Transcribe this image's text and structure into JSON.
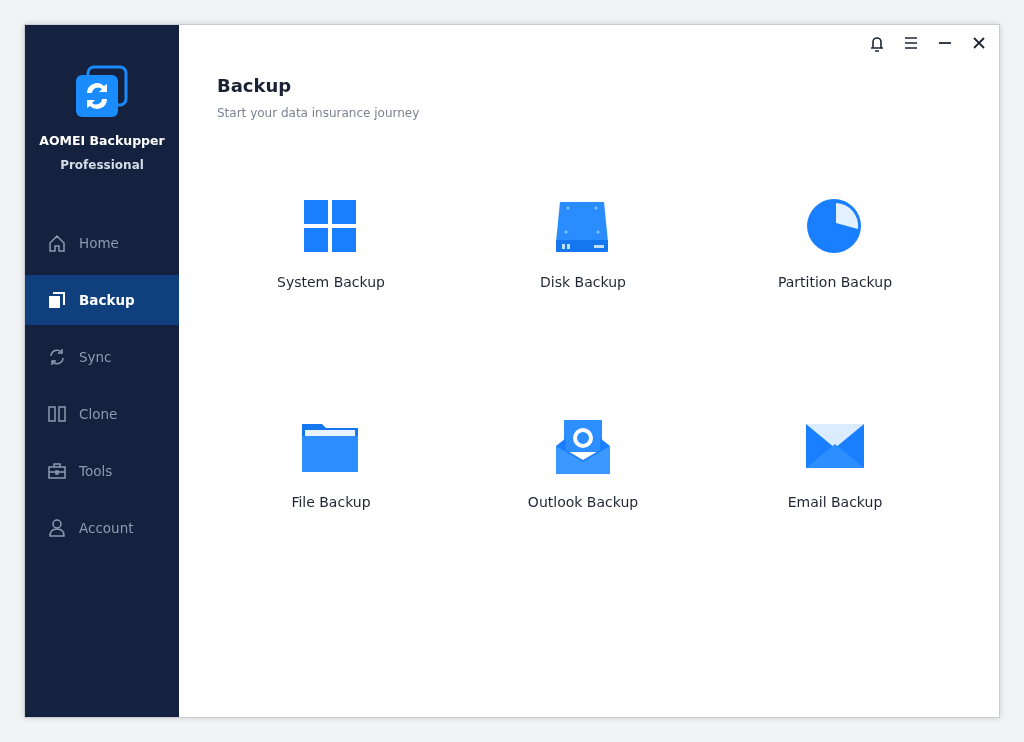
{
  "app": {
    "name": "AOMEI Backupper",
    "edition": "Professional"
  },
  "nav": [
    {
      "label": "Home",
      "kind": "home",
      "selected": false
    },
    {
      "label": "Backup",
      "kind": "backup",
      "selected": true
    },
    {
      "label": "Sync",
      "kind": "sync",
      "selected": false
    },
    {
      "label": "Clone",
      "kind": "clone",
      "selected": false
    },
    {
      "label": "Tools",
      "kind": "tools",
      "selected": false
    },
    {
      "label": "Account",
      "kind": "account",
      "selected": false
    }
  ],
  "title_bar": {
    "controls": [
      {
        "kind": "bell"
      },
      {
        "kind": "menu"
      },
      {
        "kind": "minimize"
      },
      {
        "kind": "close"
      }
    ]
  },
  "page": {
    "title": "Backup",
    "subtitle": "Start your data insurance journey"
  },
  "options": [
    {
      "label": "System Backup",
      "kind": "windows"
    },
    {
      "label": "Disk Backup",
      "kind": "disk"
    },
    {
      "label": "Partition Backup",
      "kind": "pie"
    },
    {
      "label": "File Backup",
      "kind": "folder"
    },
    {
      "label": "Outlook Backup",
      "kind": "outlook"
    },
    {
      "label": "Email Backup",
      "kind": "envelope"
    }
  ]
}
